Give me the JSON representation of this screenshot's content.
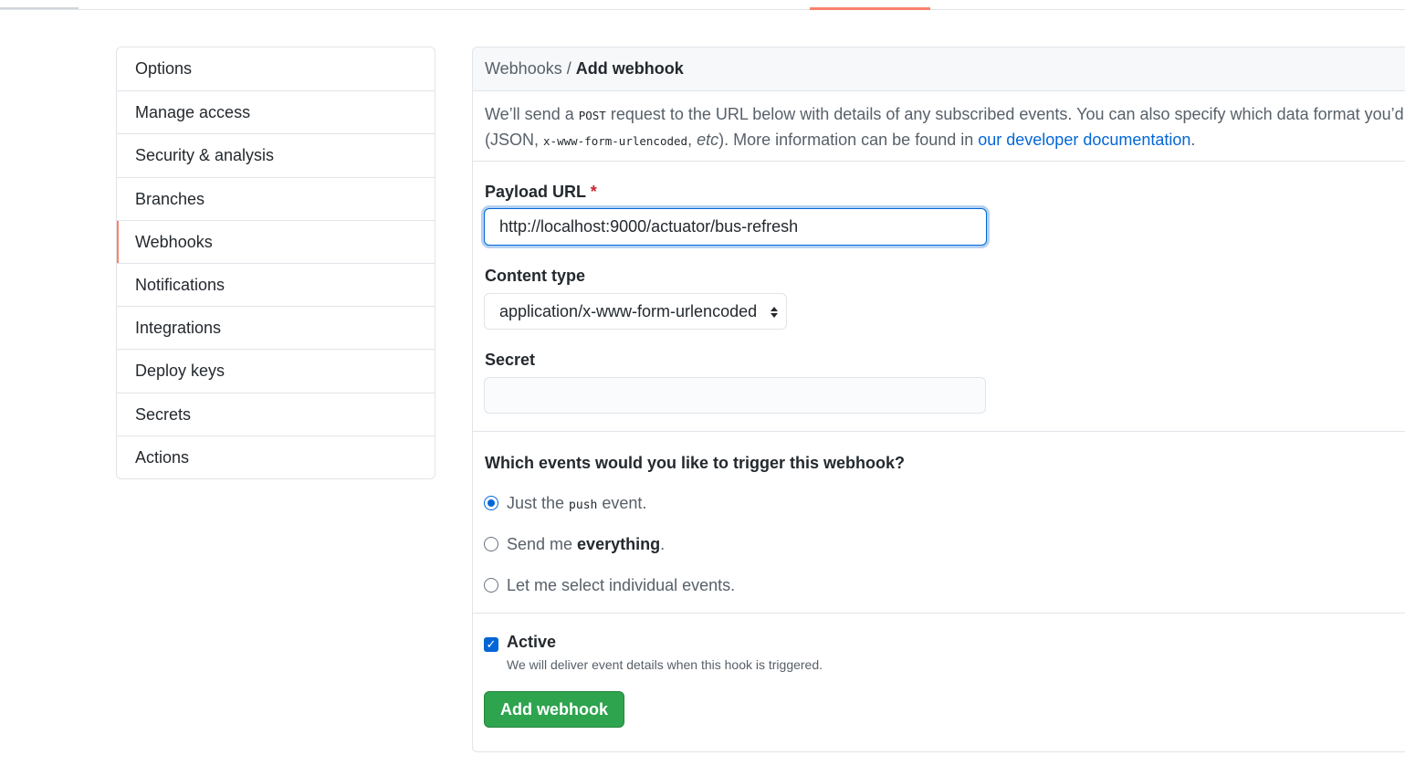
{
  "sidebar": {
    "items": [
      {
        "label": "Options"
      },
      {
        "label": "Manage access"
      },
      {
        "label": "Security & analysis"
      },
      {
        "label": "Branches"
      },
      {
        "label": "Webhooks",
        "selected": true
      },
      {
        "label": "Notifications"
      },
      {
        "label": "Integrations"
      },
      {
        "label": "Deploy keys"
      },
      {
        "label": "Secrets"
      },
      {
        "label": "Actions"
      }
    ]
  },
  "breadcrumb": {
    "parent": "Webhooks",
    "separator": " / ",
    "current": "Add webhook"
  },
  "intro": {
    "text1": "We’ll send a ",
    "code1": "POST",
    "text2": " request to the URL below with details of any subscribed events. You can also specify which data format you’d like",
    "text3": "(JSON, ",
    "code2": "x-www-form-urlencoded",
    "text4": ", ",
    "etc": "etc",
    "text5": "). More information can be found in ",
    "link": "our developer documentation",
    "text6": "."
  },
  "form": {
    "payload_url_label": "Payload URL",
    "required_mark": "*",
    "payload_url_value": "http://localhost:9000/actuator/bus-refresh",
    "content_type_label": "Content type",
    "content_type_value": "application/x-www-form-urlencoded",
    "secret_label": "Secret",
    "secret_value": ""
  },
  "events": {
    "question": "Which events would you like to trigger this webhook?",
    "options": [
      {
        "pre": "Just the ",
        "code": "push",
        "post": " event.",
        "checked": true
      },
      {
        "pre": "Send me ",
        "strong": "everything",
        "post": ".",
        "checked": false
      },
      {
        "pre": "Let me select individual events.",
        "checked": false
      }
    ]
  },
  "active": {
    "label": "Active",
    "checked": true,
    "description": "We will deliver event details when this hook is triggered."
  },
  "submit_label": "Add webhook",
  "icons": {
    "select_chevron": "chevron-up-down-icon",
    "checkbox_check": "checkmark-icon"
  },
  "colors": {
    "accent_blue": "#0366d6",
    "selected_bar": "#f9826c",
    "submit_green": "#2ea44f",
    "required_red": "#cb2431"
  }
}
